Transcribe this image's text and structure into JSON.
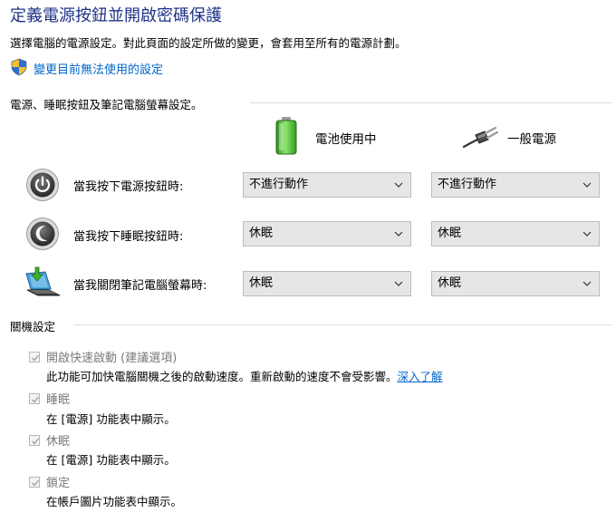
{
  "page": {
    "title": "定義電源按鈕並開啟密碼保護",
    "description": "選擇電腦的電源設定。對此頁面的設定所做的變更，會套用至所有的電源計劃。",
    "change_link": "變更目前無法使用的設定",
    "colors": {
      "title": "#1e3287",
      "link": "#0066cc",
      "disabled_text": "#7a7a7a"
    }
  },
  "power_section": {
    "label": "電源、睡眠按鈕及筆記電腦螢幕設定。",
    "columns": [
      {
        "label": "電池使用中",
        "icon": "battery-icon"
      },
      {
        "label": "一般電源",
        "icon": "power-plug-icon"
      }
    ],
    "rows": [
      {
        "label": "當我按下電源按鈕時:",
        "icon": "power-button-icon",
        "battery": "不進行動作",
        "plugged": "不進行動作"
      },
      {
        "label": "當我按下睡眠按鈕時:",
        "icon": "sleep-button-icon",
        "battery": "休眠",
        "plugged": "休眠"
      },
      {
        "label": "當我關閉筆記電腦螢幕時:",
        "icon": "laptop-lid-icon",
        "battery": "休眠",
        "plugged": "休眠"
      }
    ]
  },
  "shutdown_section": {
    "label": "關機設定",
    "options": [
      {
        "label": "開啟快速啟動 (建議選項)",
        "checked": true,
        "desc": "此功能可加快電腦關機之後的啟動速度。重新啟動的速度不會受影響。",
        "learn_more": "深入了解"
      },
      {
        "label": "睡眠",
        "checked": true,
        "desc": "在 [電源] 功能表中顯示。"
      },
      {
        "label": "休眠",
        "checked": true,
        "desc": "在 [電源] 功能表中顯示。"
      },
      {
        "label": "鎖定",
        "checked": true,
        "desc": "在帳戶圖片功能表中顯示。"
      }
    ]
  }
}
